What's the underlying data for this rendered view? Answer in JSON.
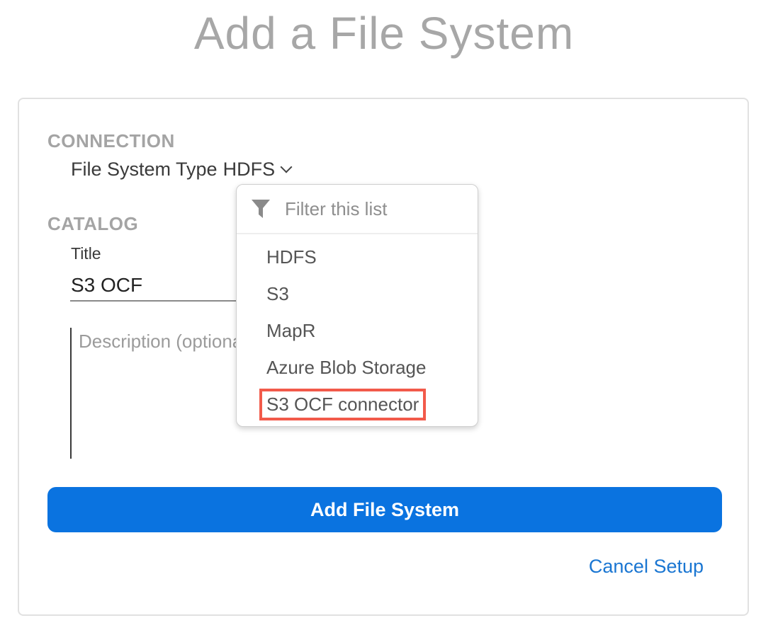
{
  "page": {
    "title": "Add a File System"
  },
  "connection": {
    "heading": "CONNECTION",
    "type_label": "File System Type",
    "type_value": "HDFS"
  },
  "catalog": {
    "heading": "CATALOG",
    "title_label": "Title",
    "title_value": "S3 OCF",
    "description_placeholder": "Description (optional)"
  },
  "dropdown": {
    "filter_placeholder": "Filter this list",
    "options": [
      {
        "label": "HDFS"
      },
      {
        "label": "S3"
      },
      {
        "label": "MapR"
      },
      {
        "label": "Azure Blob Storage"
      },
      {
        "label": "S3 OCF connector",
        "highlighted": true
      }
    ]
  },
  "actions": {
    "submit_label": "Add File System",
    "cancel_label": "Cancel Setup"
  },
  "colors": {
    "primary": "#0a73e0",
    "link": "#1a76d2",
    "highlight_border": "#f25a4a",
    "heading_gray": "#a4a4a4"
  }
}
